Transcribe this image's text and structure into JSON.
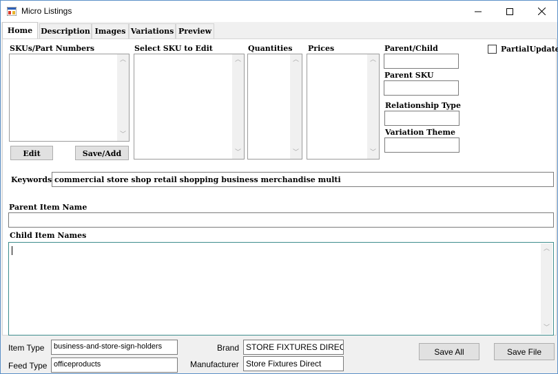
{
  "window": {
    "title": "Micro Listings"
  },
  "tabs": [
    "Home",
    "Description",
    "Images",
    "Variations",
    "Preview"
  ],
  "home": {
    "skus_label": "SKUs/Part Numbers",
    "select_sku_label": "Select SKU to Edit",
    "quantities_label": "Quantities",
    "prices_label": "Prices",
    "parent_child_label": "Parent/Child",
    "parent_child_value": "",
    "parent_sku_label": "Parent SKU",
    "parent_sku_value": "",
    "relationship_type_label": "Relationship Type",
    "relationship_type_value": "",
    "variation_theme_label": "Variation Theme",
    "variation_theme_value": "",
    "partial_update_label": "PartialUpdate",
    "partial_update_checked": false,
    "edit_button": "Edit",
    "save_add_button": "Save/Add",
    "keywords_label": "Keywords",
    "keywords_value": "commercial store shop retail shopping business merchandise multi",
    "parent_item_name_label": "Parent Item Name",
    "parent_item_name_value": "",
    "child_item_names_label": "Child Item Names",
    "child_item_names_value": ""
  },
  "footer": {
    "item_type_label": "Item Type",
    "item_type_value": "business-and-store-sign-holders",
    "feed_type_label": "Feed Type",
    "feed_type_value": "officeproducts",
    "brand_label": "Brand",
    "brand_value": "STORE FIXTURES DIRECT",
    "manufacturer_label": "Manufacturer",
    "manufacturer_value": "Store Fixtures Direct",
    "save_all_button": "Save All",
    "save_file_button": "Save File"
  },
  "icons": {
    "app": "app-window-icon",
    "minimize": "minimize-icon",
    "maximize": "maximize-icon",
    "close": "close-icon",
    "scroll_up": "chevron-up-icon",
    "scroll_down": "chevron-down-icon"
  }
}
